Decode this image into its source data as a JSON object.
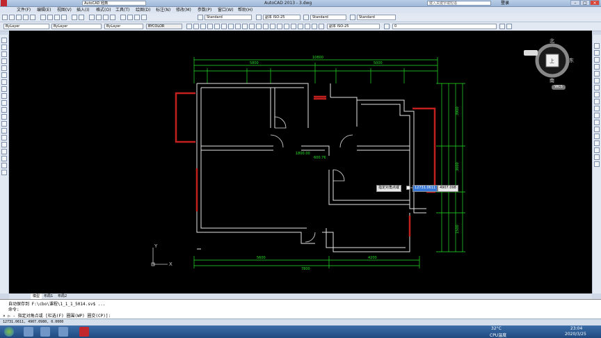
{
  "app": {
    "quick_access_title": "AutoCAD 经典",
    "title": "AutoCAD 2013  - 3.dwg",
    "search_placeholder": "键入关键字或短语",
    "sign_in": "登录"
  },
  "menu": [
    "文件(F)",
    "编辑(E)",
    "视图(V)",
    "插入(I)",
    "格式(O)",
    "工具(T)",
    "绘图(D)",
    "标注(N)",
    "修改(M)",
    "参数(P)",
    "窗口(W)",
    "帮助(H)"
  ],
  "toolbar1": {
    "text_style": "Standard",
    "dim_style": "副本 ISO-25",
    "table_style": "Standard",
    "mleader_style": "Standard"
  },
  "toolbar2": {
    "layer_label": "ByLayer",
    "linetype": "ByLayer",
    "lineweight": "ByLayer",
    "plotstyle": "BYCOLOR",
    "dim_style2": "副本 ISO-25",
    "layer_name": "0"
  },
  "viewcube": {
    "north": "北",
    "south": "南",
    "east": "东",
    "top": "上",
    "wcs": "WCS",
    "scale": "1:20"
  },
  "drawing": {
    "dim_top_total": "10800",
    "dim_top_a": "5800",
    "dim_top_b": "5000",
    "dim_bottom_total": "7800",
    "dim_bottom_a": "5600",
    "dim_bottom_b": "4200",
    "dim_inner": "1800.00",
    "dim_inner2": "600.76",
    "dim_right_a": "3900",
    "dim_right_b": "3000",
    "dim_right_c": "1500"
  },
  "tooltip": {
    "prompt": "指定对角点或",
    "x_value": "12731.0611",
    "y_value": "4907.098"
  },
  "ucs": {
    "x": "X",
    "y": "Y"
  },
  "layout_tabs": [
    "模型",
    "布局1",
    "布局2"
  ],
  "command": {
    "line1": "自动保存到 F:\\cbo\\课程\\1_1_1_5014.sv$ ...",
    "line2": "命令:",
    "line3": "× ▷ - 指定对角点或 [栏选(F) 圈围(WP) 圈交(CP)]:"
  },
  "status": {
    "coords": "12731.0611, 4907.0980, 0.0000"
  },
  "taskbar": {
    "temp": "32°C",
    "cpu": "CPU温度",
    "time": "23:04",
    "date": "2020/3/25"
  }
}
